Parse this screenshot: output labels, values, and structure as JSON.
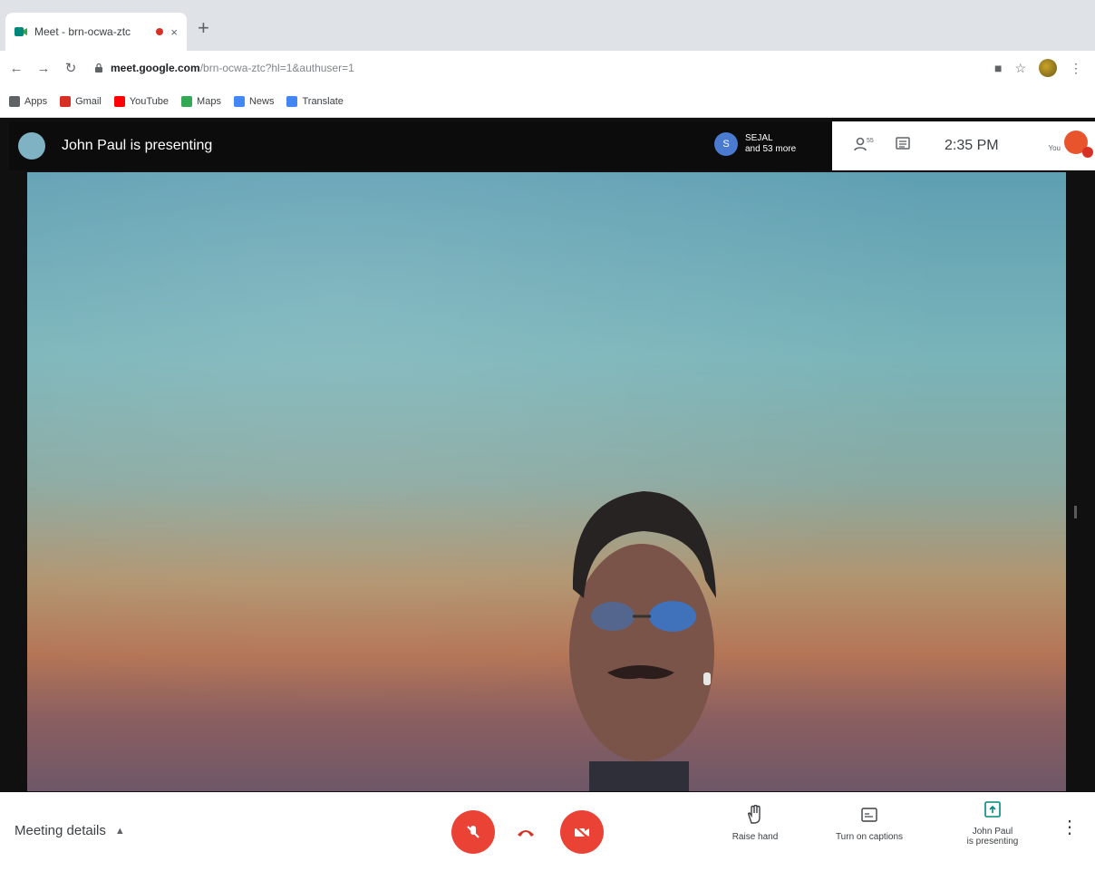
{
  "browser": {
    "tab_title": "Meet - brn-ocwa-ztc",
    "new_tab_symbol": "+",
    "close_symbol": "×",
    "url_host": "meet.google.com",
    "url_path": "/brn-ocwa-ztc?hl=1&authuser=1",
    "bookmarks": [
      {
        "label": "Apps",
        "color": "#5f6368"
      },
      {
        "label": "Gmail",
        "color": "#d93025"
      },
      {
        "label": "YouTube",
        "color": "#ff0000"
      },
      {
        "label": "Maps",
        "color": "#34a853"
      },
      {
        "label": "News",
        "color": "#4285f4"
      },
      {
        "label": "Translate",
        "color": "#4285f4"
      }
    ]
  },
  "meet": {
    "presenting_title": "John Paul is presenting",
    "participant_initial": "S",
    "participant_name": "SEJAL",
    "participant_more": "and 53 more",
    "people_count": "55",
    "time": "2:35 PM",
    "self_label": "You",
    "meeting_details_label": "Meeting details",
    "actions": {
      "raise_hand": "Raise hand",
      "captions": "Turn on captions",
      "presenting_line1": "John Paul",
      "presenting_line2": "is presenting"
    },
    "colors": {
      "danger": "#ea4335",
      "accent_green": "#00897b"
    }
  }
}
